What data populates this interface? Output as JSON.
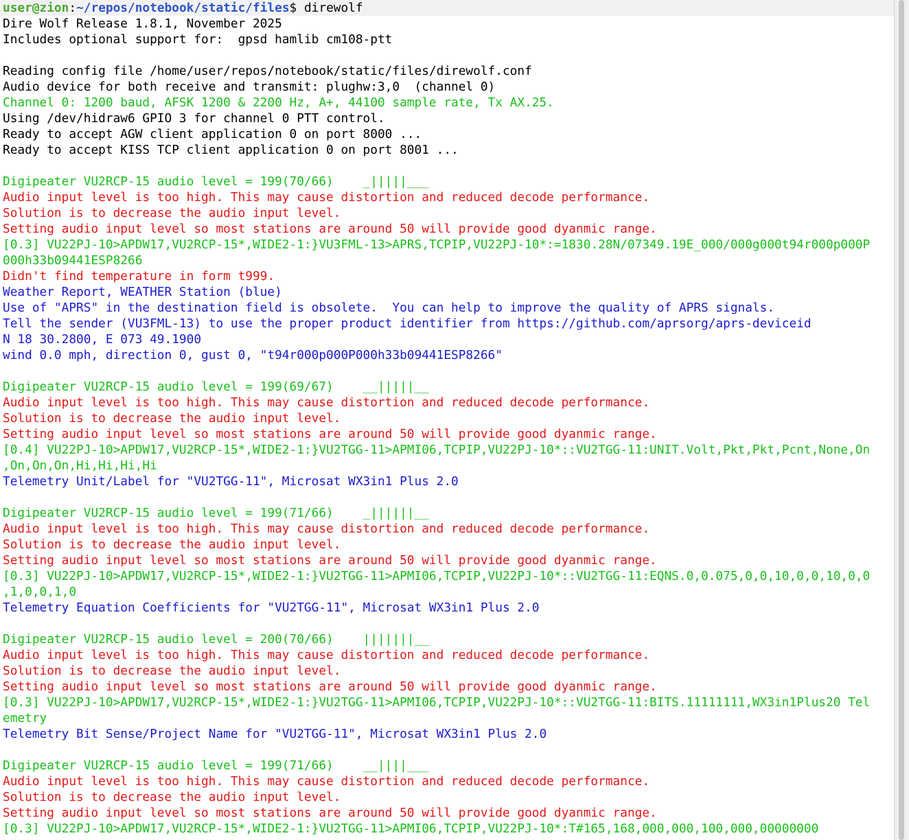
{
  "prompt": {
    "user_host": "user@zion",
    "separator": ":",
    "path": "~/repos/notebook/static/files",
    "symbol": "$ ",
    "command": "direwolf"
  },
  "colors": {
    "black": "#000000",
    "green": "#1bbf1b",
    "red": "#e11919",
    "blue": "#1c1ccf",
    "prompt_user": "#4aa830",
    "prompt_path": "#2f55c8"
  },
  "lines": [
    {
      "c": "black",
      "t": "Dire Wolf Release 1.8.1, November 2025"
    },
    {
      "c": "black",
      "t": "Includes optional support for:  gpsd hamlib cm108-ptt"
    },
    {
      "c": "black",
      "t": ""
    },
    {
      "c": "black",
      "t": "Reading config file /home/user/repos/notebook/static/files/direwolf.conf"
    },
    {
      "c": "black",
      "t": "Audio device for both receive and transmit: plughw:3,0  (channel 0)"
    },
    {
      "c": "green",
      "t": "Channel 0: 1200 baud, AFSK 1200 & 2200 Hz, A+, 44100 sample rate, Tx AX.25."
    },
    {
      "c": "black",
      "t": "Using /dev/hidraw6 GPIO 3 for channel 0 PTT control."
    },
    {
      "c": "black",
      "t": "Ready to accept AGW client application 0 on port 8000 ..."
    },
    {
      "c": "black",
      "t": "Ready to accept KISS TCP client application 0 on port 8001 ..."
    },
    {
      "c": "black",
      "t": ""
    },
    {
      "c": "green",
      "t": "Digipeater VU2RCP-15 audio level = 199(70/66)    _|||||___"
    },
    {
      "c": "red",
      "t": "Audio input level is too high. This may cause distortion and reduced decode performance."
    },
    {
      "c": "red",
      "t": "Solution is to decrease the audio input level."
    },
    {
      "c": "red",
      "t": "Setting audio input level so most stations are around 50 will provide good dyanmic range."
    },
    {
      "c": "green",
      "t": "[0.3] VU22PJ-10>APDW17,VU2RCP-15*,WIDE2-1:}VU3FML-13>APRS,TCPIP,VU22PJ-10*:=1830.28N/07349.19E_000/000g000t94r000p000P"
    },
    {
      "c": "green",
      "t": "000h33b09441ESP8266"
    },
    {
      "c": "red",
      "t": "Didn't find temperature in form t999."
    },
    {
      "c": "blue",
      "t": "Weather Report, WEATHER Station (blue)"
    },
    {
      "c": "blue",
      "t": "Use of \"APRS\" in the destination field is obsolete.  You can help to improve the quality of APRS signals."
    },
    {
      "c": "blue",
      "t": "Tell the sender (VU3FML-13) to use the proper product identifier from https://github.com/aprsorg/aprs-deviceid"
    },
    {
      "c": "blue",
      "t": "N 18 30.2800, E 073 49.1900"
    },
    {
      "c": "blue",
      "t": "wind 0.0 mph, direction 0, gust 0, \"t94r000p000P000h33b09441ESP8266\""
    },
    {
      "c": "black",
      "t": ""
    },
    {
      "c": "green",
      "t": "Digipeater VU2RCP-15 audio level = 199(69/67)    __|||||__"
    },
    {
      "c": "red",
      "t": "Audio input level is too high. This may cause distortion and reduced decode performance."
    },
    {
      "c": "red",
      "t": "Solution is to decrease the audio input level."
    },
    {
      "c": "red",
      "t": "Setting audio input level so most stations are around 50 will provide good dyanmic range."
    },
    {
      "c": "green",
      "t": "[0.4] VU22PJ-10>APDW17,VU2RCP-15*,WIDE2-1:}VU2TGG-11>APMI06,TCPIP,VU22PJ-10*::VU2TGG-11:UNIT.Volt,Pkt,Pkt,Pcnt,None,On"
    },
    {
      "c": "green",
      "t": ",On,On,On,Hi,Hi,Hi,Hi"
    },
    {
      "c": "blue",
      "t": "Telemetry Unit/Label for \"VU2TGG-11\", Microsat WX3in1 Plus 2.0"
    },
    {
      "c": "black",
      "t": ""
    },
    {
      "c": "green",
      "t": "Digipeater VU2RCP-15 audio level = 199(71/66)    _||||||__"
    },
    {
      "c": "red",
      "t": "Audio input level is too high. This may cause distortion and reduced decode performance."
    },
    {
      "c": "red",
      "t": "Solution is to decrease the audio input level."
    },
    {
      "c": "red",
      "t": "Setting audio input level so most stations are around 50 will provide good dyanmic range."
    },
    {
      "c": "green",
      "t": "[0.3] VU22PJ-10>APDW17,VU2RCP-15*,WIDE2-1:}VU2TGG-11>APMI06,TCPIP,VU22PJ-10*::VU2TGG-11:EQNS.0,0.075,0,0,10,0,0,10,0,0"
    },
    {
      "c": "green",
      "t": ",1,0,0,1,0"
    },
    {
      "c": "blue",
      "t": "Telemetry Equation Coefficients for \"VU2TGG-11\", Microsat WX3in1 Plus 2.0"
    },
    {
      "c": "black",
      "t": ""
    },
    {
      "c": "green",
      "t": "Digipeater VU2RCP-15 audio level = 200(70/66)    |||||||__"
    },
    {
      "c": "red",
      "t": "Audio input level is too high. This may cause distortion and reduced decode performance."
    },
    {
      "c": "red",
      "t": "Solution is to decrease the audio input level."
    },
    {
      "c": "red",
      "t": "Setting audio input level so most stations are around 50 will provide good dyanmic range."
    },
    {
      "c": "green",
      "t": "[0.3] VU22PJ-10>APDW17,VU2RCP-15*,WIDE2-1:}VU2TGG-11>APMI06,TCPIP,VU22PJ-10*::VU2TGG-11:BITS.11111111,WX3in1Plus20 Tel"
    },
    {
      "c": "green",
      "t": "emetry"
    },
    {
      "c": "blue",
      "t": "Telemetry Bit Sense/Project Name for \"VU2TGG-11\", Microsat WX3in1 Plus 2.0"
    },
    {
      "c": "black",
      "t": ""
    },
    {
      "c": "green",
      "t": "Digipeater VU2RCP-15 audio level = 199(71/66)    __||||___"
    },
    {
      "c": "red",
      "t": "Audio input level is too high. This may cause distortion and reduced decode performance."
    },
    {
      "c": "red",
      "t": "Solution is to decrease the audio input level."
    },
    {
      "c": "red",
      "t": "Setting audio input level so most stations are around 50 will provide good dyanmic range."
    },
    {
      "c": "green",
      "t": "[0.3] VU22PJ-10>APDW17,VU2RCP-15*,WIDE2-1:}VU2TGG-11>APMI06,TCPIP,VU22PJ-10*:T#165,168,000,000,100,000,00000000"
    }
  ]
}
